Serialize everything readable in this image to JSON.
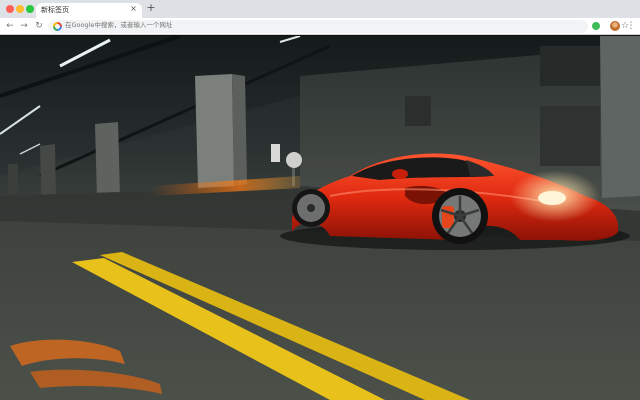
{
  "browser": {
    "tab": {
      "title": "新标签页",
      "close_icon": "×"
    },
    "new_tab_icon": "+",
    "nav": {
      "back_icon": "←",
      "forward_icon": "→",
      "reload_icon": "↻"
    },
    "omnibox": {
      "placeholder": "在Google中搜索，或者输入一个网址"
    },
    "star_icon": "☆",
    "menu_icon": "⋮"
  },
  "wallpaper": {
    "subject": "red sports car in underground parking garage",
    "colors": {
      "car": "#e02a10",
      "road_line": "#e8c21a",
      "ceiling": "#1a1f1f"
    }
  }
}
